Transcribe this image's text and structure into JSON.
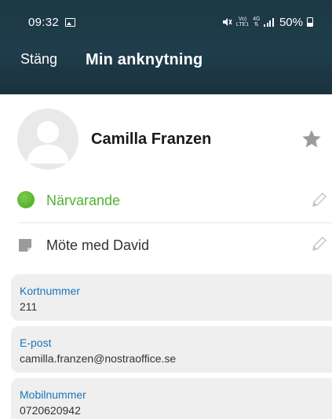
{
  "status_bar": {
    "time": "09:32",
    "network_top": "Vo)",
    "network_mid": "LTE1",
    "network_type": "4G",
    "battery": "50%"
  },
  "app_bar": {
    "close_label": "Stäng",
    "title": "Min anknytning",
    "background_color": "#1f3d4a"
  },
  "contact": {
    "name": "Camilla Franzen",
    "favorite": false
  },
  "presence": {
    "label": "Närvarande",
    "color": "#4fb235"
  },
  "message": {
    "text": "Möte med David"
  },
  "info": [
    {
      "label": "Kortnummer",
      "value": "211"
    },
    {
      "label": "E-post",
      "value": "camilla.franzen@nostraoffice.se"
    },
    {
      "label": "Mobilnummer",
      "value": "0720620942"
    }
  ],
  "accent_color": "#1f74b8"
}
